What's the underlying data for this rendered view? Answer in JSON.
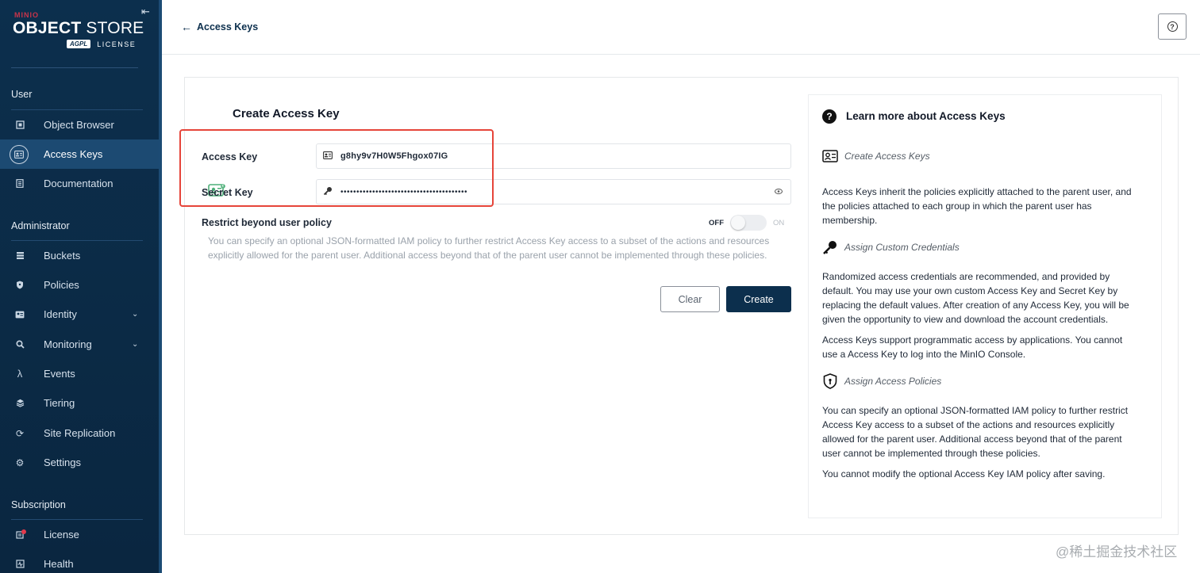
{
  "sidebar": {
    "logo": {
      "brand": "MINIO",
      "product_bold": "OBJECT",
      "product_rest": " STORE",
      "badge": "AGPL",
      "license": "LICENSE"
    },
    "sections": {
      "user": "User",
      "administrator": "Administrator",
      "subscription": "Subscription"
    },
    "user_items": [
      {
        "label": "Object Browser",
        "icon": "bucket-browser-icon"
      },
      {
        "label": "Access Keys",
        "icon": "key-card-icon",
        "active": true
      },
      {
        "label": "Documentation",
        "icon": "document-icon"
      }
    ],
    "admin_items": [
      {
        "label": "Buckets",
        "icon": "buckets-icon"
      },
      {
        "label": "Policies",
        "icon": "policy-shield-icon"
      },
      {
        "label": "Identity",
        "icon": "identity-icon"
      },
      {
        "label": "Monitoring",
        "icon": "monitoring-icon"
      },
      {
        "label": "Events",
        "icon": "lambda-icon"
      },
      {
        "label": "Tiering",
        "icon": "tiering-icon"
      },
      {
        "label": "Site Replication",
        "icon": "replication-icon"
      },
      {
        "label": "Settings",
        "icon": "gear-icon"
      }
    ],
    "subscription_items": [
      {
        "label": "License",
        "icon": "license-icon"
      },
      {
        "label": "Health",
        "icon": "health-icon"
      }
    ]
  },
  "header": {
    "title": "Access Keys"
  },
  "form": {
    "title": "Create Access Key",
    "access_key_label": "Access Key",
    "access_key_value": "g8hy9v7H0W5Fhgox07IG",
    "secret_key_label": "Secret Key",
    "secret_key_masked": "••••••••••••••••••••••••••••••••••••••••",
    "restrict_label": "Restrict beyond user policy",
    "toggle_off": "OFF",
    "toggle_on": "ON",
    "restrict_description": "You can specify an optional JSON-formatted IAM policy to further restrict Access Key access to a subset of the actions and resources explicitly allowed for the parent user. Additional access beyond that of the parent user cannot be implemented through these policies.",
    "clear_label": "Clear",
    "create_label": "Create"
  },
  "help": {
    "title": "Learn more about Access Keys",
    "create_heading": "Create Access Keys",
    "create_text": "Access Keys inherit the policies explicitly attached to the parent user, and the policies attached to each group in which the parent user has membership.",
    "custom_heading": "Assign Custom Credentials",
    "custom_text_1": "Randomized access credentials are recommended, and provided by default. You may use your own custom Access Key and Secret Key by replacing the default values. After creation of any Access Key, you will be given the opportunity to view and download the account credentials.",
    "custom_text_2": "Access Keys support programmatic access by applications. You cannot use a Access Key to log into the MinIO Console.",
    "policies_heading": "Assign Access Policies",
    "policies_text_1": "You can specify an optional JSON-formatted IAM policy to further restrict Access Key access to a subset of the actions and resources explicitly allowed for the parent user. Additional access beyond that of the parent user cannot be implemented through these policies.",
    "policies_text_2": "You cannot modify the optional Access Key IAM policy after saving."
  },
  "watermark": "@稀土掘金技术社区",
  "colors": {
    "sidebar_bg": "#0c2f4d",
    "primary": "#0c2f4d",
    "highlight": "#e6453a"
  }
}
